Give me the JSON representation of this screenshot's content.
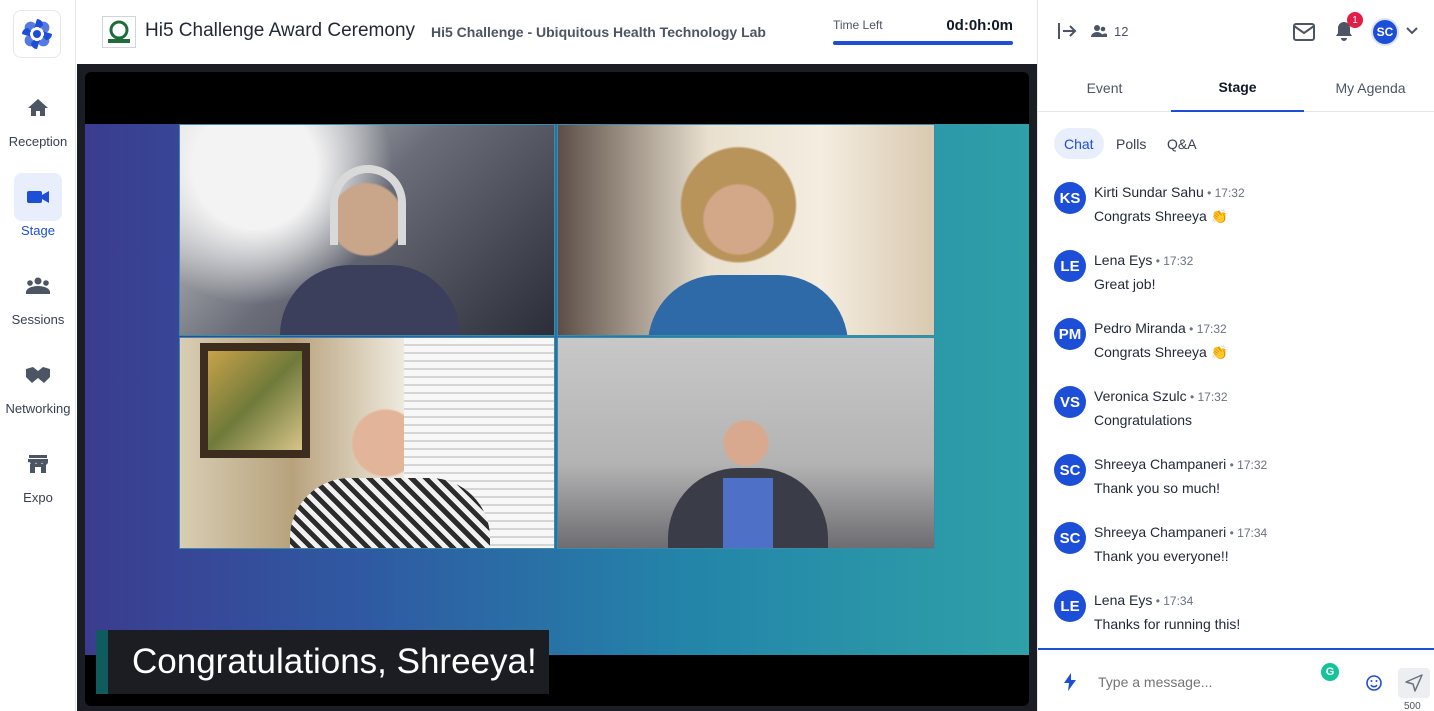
{
  "nav": {
    "items": [
      {
        "label": "Reception",
        "icon": "home-icon"
      },
      {
        "label": "Stage",
        "icon": "video-camera-icon",
        "active": true
      },
      {
        "label": "Sessions",
        "icon": "group-icon"
      },
      {
        "label": "Networking",
        "icon": "handshake-icon"
      },
      {
        "label": "Expo",
        "icon": "store-icon"
      }
    ]
  },
  "header": {
    "event_title": "Hi5 Challenge Award Ceremony",
    "organizer": "Hi5 Challenge - Ubiquitous Health Technology Lab",
    "time_left_label": "Time Left",
    "time_left_value": "0d:0h:0m",
    "accent": "#1d4ed8"
  },
  "stage": {
    "caption": "Congratulations, Shreeya!"
  },
  "right_panel": {
    "people_count": "12",
    "notification_count": "1",
    "user_initials": "SC",
    "tabs": [
      "Event",
      "Stage",
      "My Agenda"
    ],
    "active_tab": "Stage",
    "subtabs": [
      "Chat",
      "Polls",
      "Q&A"
    ],
    "active_subtab": "Chat",
    "messages": [
      {
        "initials": "KS",
        "name": "Kirti Sundar Sahu",
        "time": "17:32",
        "text": "Congrats Shreeya 👏"
      },
      {
        "initials": "LE",
        "name": "Lena Eys",
        "time": "17:32",
        "text": "Great job!"
      },
      {
        "initials": "PM",
        "name": "Pedro Miranda",
        "time": "17:32",
        "text": "Congrats Shreeya 👏"
      },
      {
        "initials": "VS",
        "name": "Veronica Szulc",
        "time": "17:32",
        "text": "Congratulations"
      },
      {
        "initials": "SC",
        "name": "Shreeya Champaneri",
        "time": "17:32",
        "text": "Thank you so much!"
      },
      {
        "initials": "SC",
        "name": "Shreeya Champaneri",
        "time": "17:34",
        "text": "Thank you everyone!!"
      },
      {
        "initials": "LE",
        "name": "Lena Eys",
        "time": "17:34",
        "text": "Thanks for running this!"
      }
    ],
    "composer": {
      "placeholder": "Type a message...",
      "char_limit": "500",
      "grammarly_letter": "G"
    }
  }
}
